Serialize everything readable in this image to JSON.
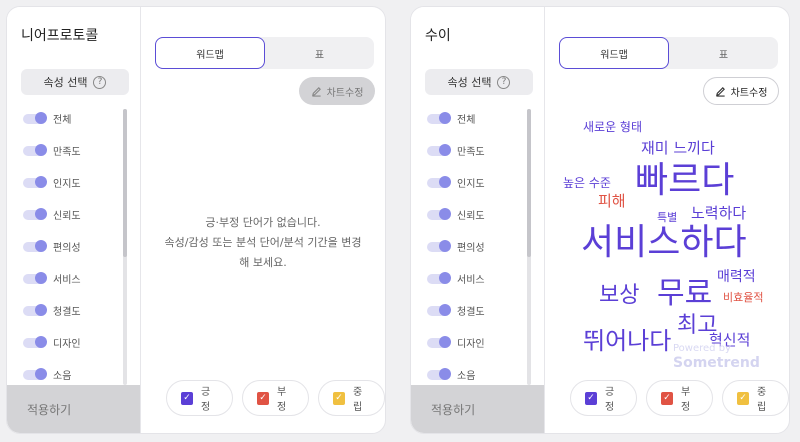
{
  "attr_select_label": "속성 선택",
  "help_icon": "?",
  "attributes": [
    "전체",
    "만족도",
    "인지도",
    "신뢰도",
    "편의성",
    "서비스",
    "청결도",
    "디자인",
    "소음"
  ],
  "apply_label": "적용하기",
  "tabs": {
    "wordmap": "워드맵",
    "table": "표"
  },
  "edit_chart_label": "차트수정",
  "legend": [
    {
      "label": "긍정",
      "color": "#5b3fd6"
    },
    {
      "label": "부정",
      "color": "#e05344"
    },
    {
      "label": "중립",
      "color": "#f0c040"
    }
  ],
  "left_panel": {
    "title": "니어프로토콜",
    "empty_line1": "긍·부정 단어가 없습니다.",
    "empty_line2": "속성/감성 또는 분석 단어/분석 기간을 변경",
    "empty_line3": "해 보세요."
  },
  "right_panel": {
    "title": "수이",
    "words": [
      {
        "text": "새로운 형태",
        "sentiment": "positive"
      },
      {
        "text": "재미 느끼다",
        "sentiment": "positive"
      },
      {
        "text": "높은 수준",
        "sentiment": "positive"
      },
      {
        "text": "빠르다",
        "sentiment": "positive"
      },
      {
        "text": "피해",
        "sentiment": "negative"
      },
      {
        "text": "특별",
        "sentiment": "positive"
      },
      {
        "text": "노력하다",
        "sentiment": "positive"
      },
      {
        "text": "서비스하다",
        "sentiment": "positive"
      },
      {
        "text": "매력적",
        "sentiment": "positive"
      },
      {
        "text": "보상",
        "sentiment": "positive"
      },
      {
        "text": "무료",
        "sentiment": "positive"
      },
      {
        "text": "비효율적",
        "sentiment": "negative"
      },
      {
        "text": "최고",
        "sentiment": "positive"
      },
      {
        "text": "뛰어나다",
        "sentiment": "positive"
      },
      {
        "text": "혁신적",
        "sentiment": "positive"
      }
    ],
    "watermark_line1": "Powered by",
    "watermark_line2": "Sometrend"
  }
}
